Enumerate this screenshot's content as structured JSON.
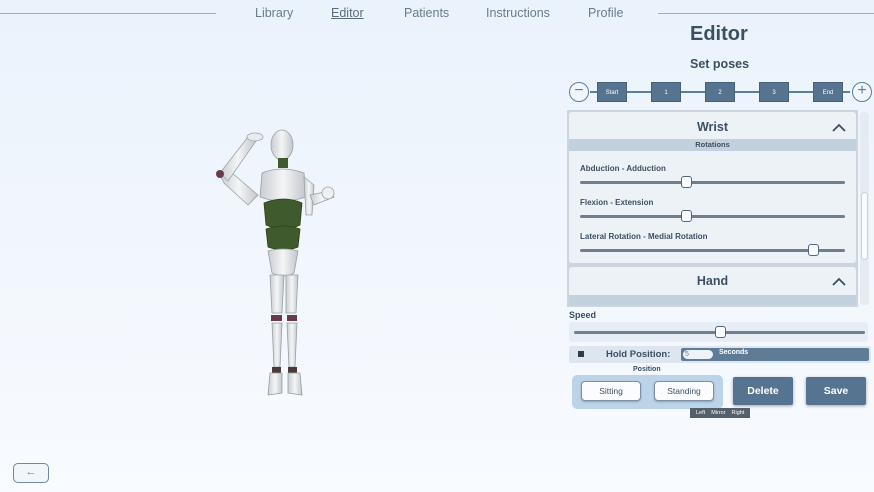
{
  "nav": {
    "items": [
      {
        "label": "Library"
      },
      {
        "label": "Editor",
        "active": true
      },
      {
        "label": "Patients"
      },
      {
        "label": "Instructions"
      },
      {
        "label": "Profile"
      }
    ]
  },
  "editor": {
    "title": "Editor",
    "subtitle": "Set poses",
    "minus_icon": "minus-circle-icon",
    "plus_icon": "plus-circle-icon",
    "poses": [
      "Start",
      "1",
      "2",
      "3",
      "End"
    ]
  },
  "wrist": {
    "title": "Wrist",
    "section": "Rotations",
    "rotations": [
      {
        "label": "Abduction - Adduction",
        "value": 0.4
      },
      {
        "label": "Flexion - Extension",
        "value": 0.4
      },
      {
        "label": "Lateral Rotation - Medial Rotation",
        "value": 0.88
      }
    ]
  },
  "hand": {
    "title": "Hand"
  },
  "speed": {
    "label": "Speed",
    "value": 0.5
  },
  "hold": {
    "label": "Hold Position:",
    "value": "5",
    "unit": "Seconds"
  },
  "position": {
    "title": "Position",
    "sitting": "Sitting",
    "standing": "Standing"
  },
  "actions": {
    "delete": "Delete",
    "save": "Save"
  },
  "tooltip": {
    "left": "Left",
    "mirror": "Mirror",
    "right": "Right"
  },
  "back": {
    "label": "←"
  },
  "colors": {
    "accent": "#56748f",
    "torso": "#3f5a2c",
    "panel": "#cbd5df"
  }
}
